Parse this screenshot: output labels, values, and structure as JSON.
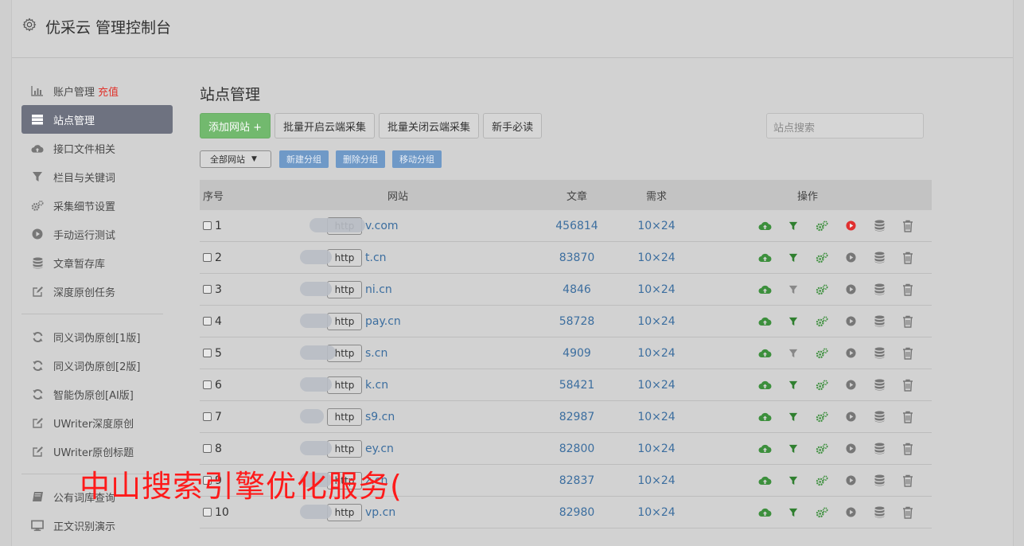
{
  "header": {
    "title": "优采云 管理控制台"
  },
  "sidebar": {
    "group1": [
      {
        "label": "账户管理",
        "extra": "充值",
        "icon": "bar-chart-icon"
      },
      {
        "label": "站点管理",
        "icon": "server-icon",
        "active": true
      },
      {
        "label": "接口文件相关",
        "icon": "cloud-upload-icon"
      },
      {
        "label": "栏目与关键词",
        "icon": "filter-icon"
      },
      {
        "label": "采集细节设置",
        "icon": "cogs-icon"
      },
      {
        "label": "手动运行测试",
        "icon": "play-icon"
      },
      {
        "label": "文章暂存库",
        "icon": "database-icon"
      },
      {
        "label": "深度原创任务",
        "icon": "edit-icon"
      }
    ],
    "group2": [
      {
        "label": "同义词伪原创[1版]",
        "icon": "refresh-icon"
      },
      {
        "label": "同义词伪原创[2版]",
        "icon": "refresh-icon"
      },
      {
        "label": "智能伪原创[AI版]",
        "icon": "refresh-icon"
      },
      {
        "label": "UWriter深度原创",
        "icon": "edit-icon"
      },
      {
        "label": "UWriter原创标题",
        "icon": "edit-icon"
      }
    ],
    "group3": [
      {
        "label": "公有词库查询",
        "icon": "book-icon"
      },
      {
        "label": "正文识别演示",
        "icon": "monitor-icon"
      }
    ]
  },
  "main": {
    "title": "站点管理",
    "buttons": {
      "add": "添加网站 +",
      "enable": "批量开启云端采集",
      "disable": "批量关闭云端采集",
      "guide": "新手必读"
    },
    "search_placeholder": "站点搜索",
    "group_select": "全部网站",
    "group_buttons": {
      "new": "新建分组",
      "delete": "删除分组",
      "move": "移动分组"
    },
    "columns": {
      "no": "序号",
      "site": "网站",
      "articles": "文章",
      "demand": "需求",
      "ops": "操作"
    },
    "rows": [
      {
        "no": "1",
        "protocol": "http",
        "domain": "v.com",
        "articles": "456814",
        "demand": "10×24",
        "run_active": true,
        "filter_active": true
      },
      {
        "no": "2",
        "protocol": "http",
        "domain": "t.cn",
        "articles": "83870",
        "demand": "10×24",
        "run_active": false,
        "filter_active": true
      },
      {
        "no": "3",
        "protocol": "http",
        "domain": "ni.cn",
        "articles": "4846",
        "demand": "10×24",
        "run_active": false,
        "filter_active": false
      },
      {
        "no": "4",
        "protocol": "http",
        "domain": "pay.cn",
        "articles": "58728",
        "demand": "10×24",
        "run_active": false,
        "filter_active": true
      },
      {
        "no": "5",
        "protocol": "http",
        "domain": "s.cn",
        "articles": "4909",
        "demand": "10×24",
        "run_active": false,
        "filter_active": false
      },
      {
        "no": "6",
        "protocol": "http",
        "domain": "k.cn",
        "articles": "58421",
        "demand": "10×24",
        "run_active": false,
        "filter_active": true
      },
      {
        "no": "7",
        "protocol": "http",
        "domain": "s9.cn",
        "articles": "82987",
        "demand": "10×24",
        "run_active": false,
        "filter_active": true
      },
      {
        "no": "8",
        "protocol": "http",
        "domain": "ey.cn",
        "articles": "82800",
        "demand": "10×24",
        "run_active": false,
        "filter_active": true
      },
      {
        "no": "9",
        "protocol": "http",
        "domain": "z.cn",
        "articles": "82837",
        "demand": "10×24",
        "run_active": false,
        "filter_active": true
      },
      {
        "no": "10",
        "protocol": "http",
        "domain": "vp.cn",
        "articles": "82980",
        "demand": "10×24",
        "run_active": false,
        "filter_active": true
      }
    ]
  },
  "overlay_text": "中山搜索引擎优化服务(",
  "colors": {
    "active_nav": "#6e7280",
    "add_button": "#72b96e",
    "group_button": "#6f99c7",
    "link": "#3c6e9f",
    "recharge": "#e0332c",
    "run_active": "#e03030",
    "upload_icon": "#3c8f3c"
  }
}
